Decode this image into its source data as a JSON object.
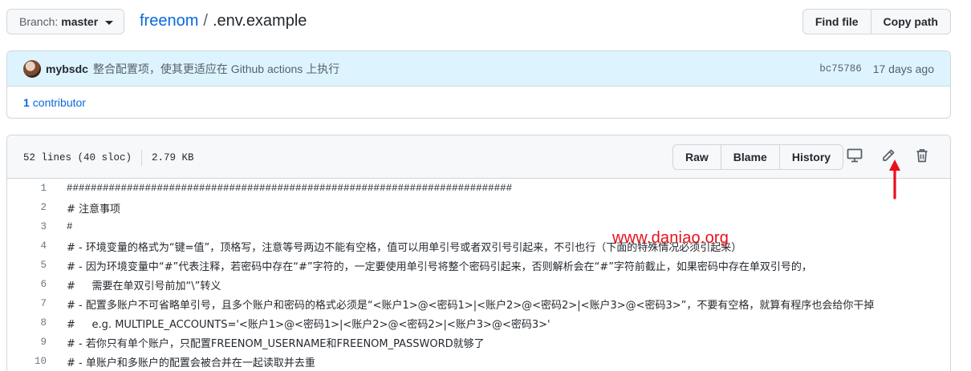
{
  "header": {
    "branch_label": "Branch:",
    "branch_value": "master",
    "repo": "freenom",
    "separator": "/",
    "file": ".env.example",
    "find_file": "Find file",
    "copy_path": "Copy path"
  },
  "commit": {
    "author": "mybsdc",
    "message": "整合配置项，使其更适应在 Github actions 上执行",
    "sha": "bc75786",
    "time": "17 days ago",
    "contributors_count": "1",
    "contributors_label": "contributor"
  },
  "file": {
    "lines_info": "52 lines (40 sloc)",
    "size": "2.79 KB",
    "raw": "Raw",
    "blame": "Blame",
    "history": "History",
    "icons": [
      "desktop-icon",
      "pencil-icon",
      "trash-icon"
    ]
  },
  "code_lines": [
    {
      "n": "1",
      "text": "##########################################################################"
    },
    {
      "n": "2",
      "text": "# 注意事项"
    },
    {
      "n": "3",
      "text": "#"
    },
    {
      "n": "4",
      "text": "# - 环境变量的格式为“键=值”，顶格写，注意等号两边不能有空格，值可以用单引号或者双引号引起来，不引也行（下面的特殊情况必须引起来）"
    },
    {
      "n": "5",
      "text": "# - 因为环境变量中“#”代表注释，若密码中存在“#”字符的，一定要使用单引号将整个密码引起来，否则解析会在“#”字符前截止，如果密码中存在单双引号的，"
    },
    {
      "n": "6",
      "text": "#     需要在单双引号前加“\\”转义"
    },
    {
      "n": "7",
      "text": "# - 配置多账户不可省略单引号，且多个账户和密码的格式必须是“<账户1>@<密码1>|<账户2>@<密码2>|<账户3>@<密码3>”，不要有空格，就算有程序也会给你干掉"
    },
    {
      "n": "8",
      "text": "#     e.g. MULTIPLE_ACCOUNTS='<账户1>@<密码1>|<账户2>@<密码2>|<账户3>@<密码3>'"
    },
    {
      "n": "9",
      "text": "# - 若你只有单个账户，只配置FREENOM_USERNAME和FREENOM_PASSWORD就够了"
    },
    {
      "n": "10",
      "text": "# - 单账户和多账户的配置会被合并在一起读取并去重"
    }
  ],
  "watermark": "www.daniao.org",
  "colors": {
    "link": "#0969da",
    "watermark": "#e8101a",
    "commit_bg": "#ddf4ff"
  }
}
